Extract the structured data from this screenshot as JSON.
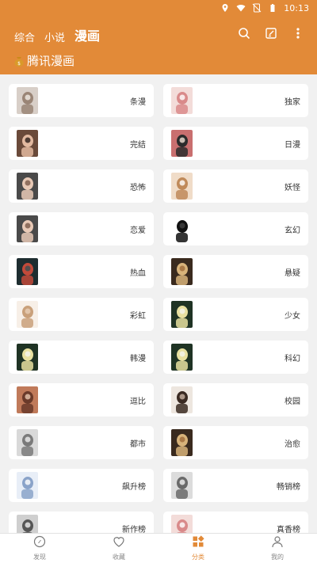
{
  "status": {
    "time": "10:13"
  },
  "header": {
    "tabs": [
      {
        "label": "综合"
      },
      {
        "label": "小说"
      },
      {
        "label": "漫画"
      }
    ],
    "subtitle": "腾讯漫画",
    "icons": [
      "search-icon",
      "edit-icon",
      "more-vert-icon"
    ]
  },
  "categories": [
    {
      "label": "条漫",
      "thumb": [
        "#d8cfc8",
        "#9a8576",
        "#f2ece6"
      ]
    },
    {
      "label": "独家",
      "thumb": [
        "#f3dcd9",
        "#d98a8a",
        "#ffffff"
      ]
    },
    {
      "label": "完结",
      "thumb": [
        "#6a4a3a",
        "#e2b9a0",
        "#2a1e1a"
      ]
    },
    {
      "label": "日漫",
      "thumb": [
        "#c96f6f",
        "#2b2b2b",
        "#f3e2d6"
      ]
    },
    {
      "label": "恐怖",
      "thumb": [
        "#4a4a4a",
        "#e8c9b6",
        "#7a5a4a"
      ]
    },
    {
      "label": "妖怪",
      "thumb": [
        "#f0dcc8",
        "#c08a5a",
        "#ffffff"
      ]
    },
    {
      "label": "恋爱",
      "thumb": [
        "#4a4a4a",
        "#e8c9b6",
        "#7a5a4a"
      ]
    },
    {
      "label": "玄幻",
      "thumb": [
        "#ffffff",
        "#111111",
        "#444444"
      ]
    },
    {
      "label": "热血",
      "thumb": [
        "#1e2d30",
        "#c24a3a",
        "#3a4d52"
      ]
    },
    {
      "label": "悬疑",
      "thumb": [
        "#3a2a1e",
        "#d8b37a",
        "#a06a3a"
      ]
    },
    {
      "label": "彩虹",
      "thumb": [
        "#f7efe7",
        "#c9a07a",
        "#e8d0b8"
      ]
    },
    {
      "label": "少女",
      "thumb": [
        "#1f3324",
        "#e8e0a0",
        "#f4f4ee"
      ]
    },
    {
      "label": "韩漫",
      "thumb": [
        "#1f3324",
        "#e8e0a0",
        "#f4f4ee"
      ]
    },
    {
      "label": "科幻",
      "thumb": [
        "#1f3324",
        "#e8e0a0",
        "#f4f4ee"
      ]
    },
    {
      "label": "逗比",
      "thumb": [
        "#c07a5a",
        "#6a3a2a",
        "#e8c8b0"
      ]
    },
    {
      "label": "校园",
      "thumb": [
        "#ede6df",
        "#3a2a22",
        "#c9b3a3"
      ]
    },
    {
      "label": "都市",
      "thumb": [
        "#d9d9d9",
        "#7a7a7a",
        "#efefef"
      ]
    },
    {
      "label": "治愈",
      "thumb": [
        "#3a2a1e",
        "#d8b37a",
        "#a06a3a"
      ]
    },
    {
      "label": "飙升榜",
      "thumb": [
        "#e8eef7",
        "#8aa3c9",
        "#ffffff"
      ]
    },
    {
      "label": "畅销榜",
      "thumb": [
        "#dcdcdc",
        "#6a6a6a",
        "#f2f2f2"
      ]
    },
    {
      "label": "新作榜",
      "thumb": [
        "#cfcfcf",
        "#555555",
        "#ededed"
      ]
    },
    {
      "label": "真香榜",
      "thumb": [
        "#f3dcd9",
        "#d98a8a",
        "#ffffff"
      ]
    }
  ],
  "bottom_nav": [
    {
      "label": "发现",
      "icon": "compass-icon"
    },
    {
      "label": "收藏",
      "icon": "heart-icon"
    },
    {
      "label": "分类",
      "icon": "category-icon",
      "active": true
    },
    {
      "label": "我的",
      "icon": "person-icon"
    }
  ],
  "colors": {
    "accent": "#e28a38",
    "background": "#f1f1f1"
  }
}
